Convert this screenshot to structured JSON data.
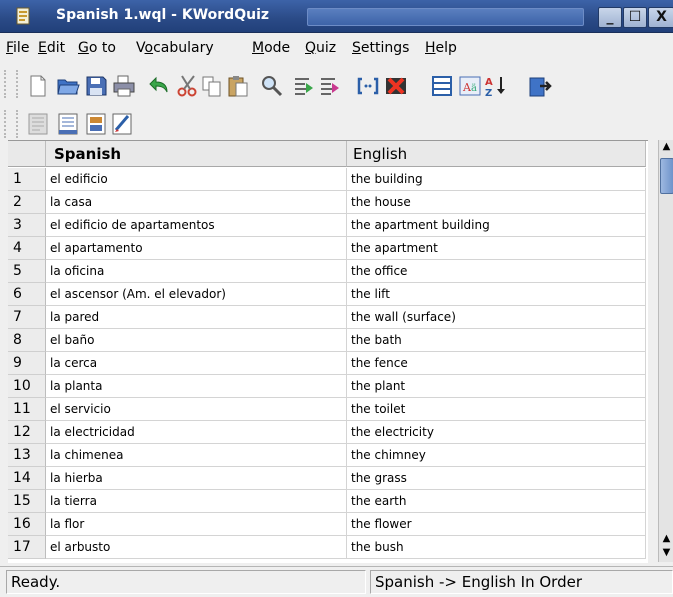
{
  "window": {
    "title": "Spanish 1.wql - KWordQuiz",
    "minimize": "_",
    "maximize": "☐",
    "close": "X"
  },
  "menu": [
    {
      "underline": "F",
      "rest": "ile"
    },
    {
      "underline": "E",
      "rest": "dit"
    },
    {
      "underline": "G",
      "rest": "o to"
    },
    {
      "pre": "V",
      "underline": "o",
      "rest": "cabulary"
    },
    {
      "underline": "M",
      "rest": "ode"
    },
    {
      "underline": "Q",
      "rest": "uiz"
    },
    {
      "underline": "S",
      "rest": "ettings"
    },
    {
      "underline": "H",
      "rest": "elp"
    }
  ],
  "toolbar_icons": [
    "new-file-icon",
    "open-folder-icon",
    "save-icon",
    "print-icon",
    "undo-icon",
    "cut-icon",
    "copy-icon",
    "paste-icon",
    "find-icon",
    "mark-left-icon",
    "mark-right-icon",
    "brackets-icon",
    "delete-icon",
    "table-icon",
    "special-char-icon",
    "sort-az-icon",
    "exit-icon"
  ],
  "toolbar2_icons": [
    "flashcard-icon",
    "multiple-choice-icon",
    "question-answer-icon"
  ],
  "table": {
    "headers": {
      "col1": "Spanish",
      "col2": "English"
    },
    "rows": [
      {
        "num": "1",
        "spanish": "el edificio",
        "english": "the building"
      },
      {
        "num": "2",
        "spanish": "la casa",
        "english": "the house"
      },
      {
        "num": "3",
        "spanish": "el edificio de apartamentos",
        "english": "the apartment building"
      },
      {
        "num": "4",
        "spanish": "el apartamento",
        "english": "the apartment"
      },
      {
        "num": "5",
        "spanish": "la oficina",
        "english": "the office"
      },
      {
        "num": "6",
        "spanish": "el ascensor (Am. el elevador)",
        "english": "the lift"
      },
      {
        "num": "7",
        "spanish": "la pared",
        "english": "the wall (surface)"
      },
      {
        "num": "8",
        "spanish": "el baño",
        "english": "the bath"
      },
      {
        "num": "9",
        "spanish": "la cerca",
        "english": "the fence"
      },
      {
        "num": "10",
        "spanish": "la planta",
        "english": "the plant"
      },
      {
        "num": "11",
        "spanish": "el servicio",
        "english": "the toilet"
      },
      {
        "num": "12",
        "spanish": "la electricidad",
        "english": "the electricity"
      },
      {
        "num": "13",
        "spanish": "la chimenea",
        "english": "the chimney"
      },
      {
        "num": "14",
        "spanish": "la hierba",
        "english": "the grass"
      },
      {
        "num": "15",
        "spanish": "la tierra",
        "english": "the earth"
      },
      {
        "num": "16",
        "spanish": "la flor",
        "english": "the flower"
      },
      {
        "num": "17",
        "spanish": "el arbusto",
        "english": "the bush"
      }
    ]
  },
  "status": {
    "left": "Ready.",
    "right": "Spanish -> English In Order"
  }
}
